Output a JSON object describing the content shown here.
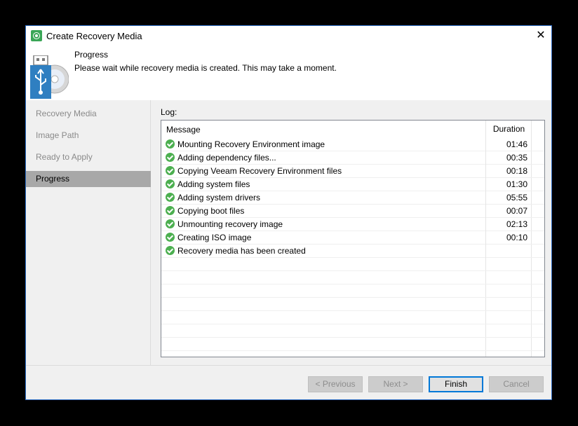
{
  "window": {
    "title": "Create Recovery Media",
    "close_glyph": "✕"
  },
  "header": {
    "title": "Progress",
    "subtitle": "Please wait while recovery media is created. This may take a moment.",
    "icon": "usb-disc-icon"
  },
  "sidebar": {
    "items": [
      {
        "label": "Recovery Media",
        "active": false
      },
      {
        "label": "Image Path",
        "active": false
      },
      {
        "label": "Ready to Apply",
        "active": false
      },
      {
        "label": "Progress",
        "active": true
      }
    ]
  },
  "log": {
    "label": "Log:",
    "columns": {
      "message": "Message",
      "duration": "Duration"
    },
    "rows": [
      {
        "message": "Mounting Recovery Environment image",
        "duration": "01:46",
        "status": "success"
      },
      {
        "message": "Adding dependency files...",
        "duration": "00:35",
        "status": "success"
      },
      {
        "message": "Copying Veeam Recovery Environment files",
        "duration": "00:18",
        "status": "success"
      },
      {
        "message": "Adding system files",
        "duration": "01:30",
        "status": "success"
      },
      {
        "message": "Adding system drivers",
        "duration": "05:55",
        "status": "success"
      },
      {
        "message": "Copying boot files",
        "duration": "00:07",
        "status": "success"
      },
      {
        "message": "Unmounting recovery image",
        "duration": "02:13",
        "status": "success"
      },
      {
        "message": "Creating ISO image",
        "duration": "00:10",
        "status": "success"
      },
      {
        "message": "Recovery media has been created",
        "duration": "",
        "status": "success"
      }
    ],
    "empty_rows": 8
  },
  "footer": {
    "previous": "< Previous",
    "next": "Next >",
    "finish": "Finish",
    "cancel": "Cancel"
  },
  "colors": {
    "accent": "#0078d7",
    "success": "#4caf50",
    "selected_nav": "#a8a8a8"
  }
}
